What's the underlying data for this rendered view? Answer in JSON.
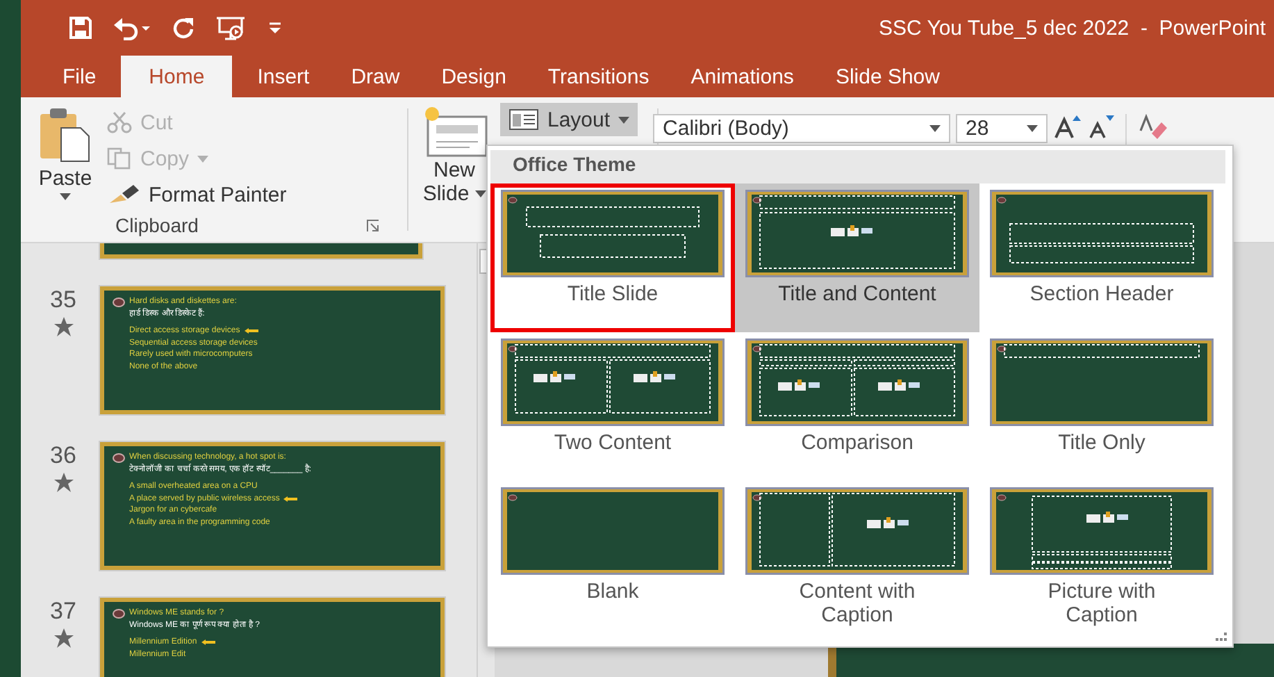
{
  "window": {
    "title": "SSC You Tube_5 dec 2022  -  PowerPoint"
  },
  "tabs": [
    {
      "label": "File",
      "selected": false
    },
    {
      "label": "Home",
      "selected": true
    },
    {
      "label": "Insert",
      "selected": false
    },
    {
      "label": "Draw",
      "selected": false
    },
    {
      "label": "Design",
      "selected": false
    },
    {
      "label": "Transitions",
      "selected": false
    },
    {
      "label": "Animations",
      "selected": false
    },
    {
      "label": "Slide Show",
      "selected": false
    }
  ],
  "ribbon": {
    "paste": "Paste",
    "cut": {
      "label": "Cut",
      "disabled": true
    },
    "copy": {
      "label": "Copy",
      "disabled": true
    },
    "format_painter": "Format Painter",
    "group_label": "Clipboard",
    "new_slide": [
      "New",
      "Slide"
    ],
    "layout": {
      "label": "Layout",
      "pressed": true
    },
    "font": {
      "family": "Calibri (Body)",
      "size": "28"
    }
  },
  "slides": [
    {
      "number": "35",
      "starred": true,
      "lines": [
        {
          "text": "Hard disks and diskettes are:",
          "kind": "question",
          "answer": false
        },
        {
          "text": "हार्ड डिस्क और डिस्केट हैं:",
          "kind": "hindi",
          "answer": false
        },
        {
          "text": "Direct access storage devices",
          "kind": "option",
          "answer": true
        },
        {
          "text": "Sequential access storage devices",
          "kind": "option",
          "answer": false
        },
        {
          "text": "Rarely used with microcomputers",
          "kind": "option",
          "answer": false
        },
        {
          "text": "None of the above",
          "kind": "option",
          "answer": false
        }
      ]
    },
    {
      "number": "36",
      "starred": true,
      "lines": [
        {
          "text": "When discussing technology, a hot spot is:",
          "kind": "question",
          "answer": false
        },
        {
          "text": "टेक्नोलॉजी का चर्चा करते समय, एक हॉट स्पॉट_______ है:",
          "kind": "hindi",
          "answer": false
        },
        {
          "text": "A small overheated area on a CPU",
          "kind": "option",
          "answer": false
        },
        {
          "text": "A place served by public wireless access",
          "kind": "option",
          "answer": true
        },
        {
          "text": "Jargon for an cybercafe",
          "kind": "option",
          "answer": false
        },
        {
          "text": "A faulty area in the programming code",
          "kind": "option",
          "answer": false
        }
      ]
    },
    {
      "number": "37",
      "starred": true,
      "lines": [
        {
          "text": "Windows ME stands for ?",
          "kind": "question",
          "answer": false
        },
        {
          "text": "Windows ME का पूर्ण रूप क्या होता है ?",
          "kind": "hindi",
          "answer": false
        },
        {
          "text": "Millennium Edition",
          "kind": "option",
          "answer": true
        },
        {
          "text": "Millennium Edit",
          "kind": "option",
          "answer": false
        }
      ]
    }
  ],
  "layout_menu": {
    "header": "Office Theme",
    "layouts": [
      {
        "label": "Title Slide",
        "kind": "title",
        "hovered": false,
        "outlined": true
      },
      {
        "label": "Title and Content",
        "kind": "title-content",
        "hovered": true,
        "outlined": false
      },
      {
        "label": "Section Header",
        "kind": "section",
        "hovered": false,
        "outlined": false
      },
      {
        "label": "Two Content",
        "kind": "two",
        "hovered": false,
        "outlined": false
      },
      {
        "label": "Comparison",
        "kind": "comparison",
        "hovered": false,
        "outlined": false
      },
      {
        "label": "Title Only",
        "kind": "title-only",
        "hovered": false,
        "outlined": false
      },
      {
        "label": "Blank",
        "kind": "blank",
        "hovered": false,
        "outlined": false
      },
      {
        "label": "Content with Caption",
        "kind": "content-caption",
        "hovered": false,
        "outlined": false
      },
      {
        "label": "Picture with Caption",
        "kind": "picture-caption",
        "hovered": false,
        "outlined": false
      }
    ]
  }
}
